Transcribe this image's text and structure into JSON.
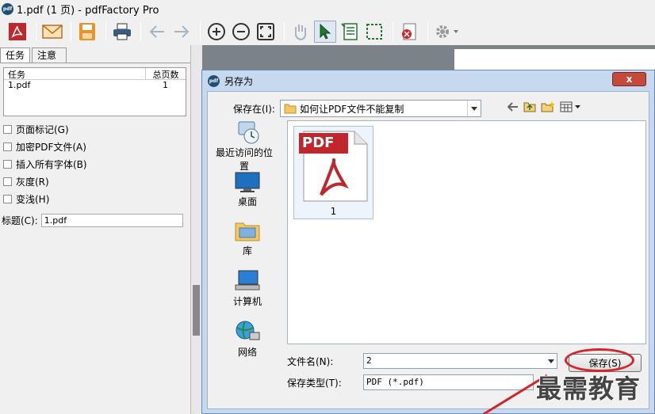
{
  "window": {
    "title": "1.pdf (1 页) - pdfFactory Pro",
    "app_logo_text": "pdf"
  },
  "toolbar": {
    "icons": [
      "pdf-save-icon",
      "email-icon",
      "save-disk-icon",
      "print-icon",
      "back-arrow-icon",
      "forward-arrow-icon",
      "zoom-in-icon",
      "zoom-out-icon",
      "fit-page-icon",
      "hand-tool-icon",
      "select-arrow-icon",
      "text-select-icon",
      "marquee-select-icon",
      "delete-page-icon",
      "settings-gear-icon"
    ]
  },
  "left_panel": {
    "tabs": [
      "任务",
      "注意"
    ],
    "task_list": {
      "headers": [
        "任务",
        "总页数"
      ],
      "rows": [
        {
          "name": "1.pdf",
          "pages": "1"
        }
      ]
    },
    "options": [
      {
        "label": "页面标记(G)",
        "checked": false
      },
      {
        "label": "加密PDF文件(A)",
        "checked": false
      },
      {
        "label": "插入所有字体(B)",
        "checked": false
      },
      {
        "label": "灰度(R)",
        "checked": false
      },
      {
        "label": "变浅(H)",
        "checked": false
      }
    ],
    "title_label": "标题(C):",
    "title_value": "1.pdf"
  },
  "dialog": {
    "title": "另存为",
    "close_label": "x",
    "save_in_label": "保存在(I):",
    "save_in_value": "如何让PDF文件不能复制",
    "places": [
      {
        "label": "最近访问的位置",
        "icon": "recent-places-icon"
      },
      {
        "label": "桌面",
        "icon": "desktop-icon"
      },
      {
        "label": "库",
        "icon": "library-icon"
      },
      {
        "label": "计算机",
        "icon": "computer-icon"
      },
      {
        "label": "网络",
        "icon": "network-icon"
      }
    ],
    "file_item": {
      "name": "1",
      "badge": "PDF"
    },
    "filename_label": "文件名(N):",
    "filename_value": "2",
    "filetype_label": "保存类型(T):",
    "filetype_value": "PDF (*.pdf)",
    "save_button": "保存(S)"
  },
  "watermark": "最需教育",
  "colors": {
    "highlight_red": "#d2262a",
    "dialog_frame": "#c7d9ee",
    "preview_bg": "#7b8389"
  }
}
